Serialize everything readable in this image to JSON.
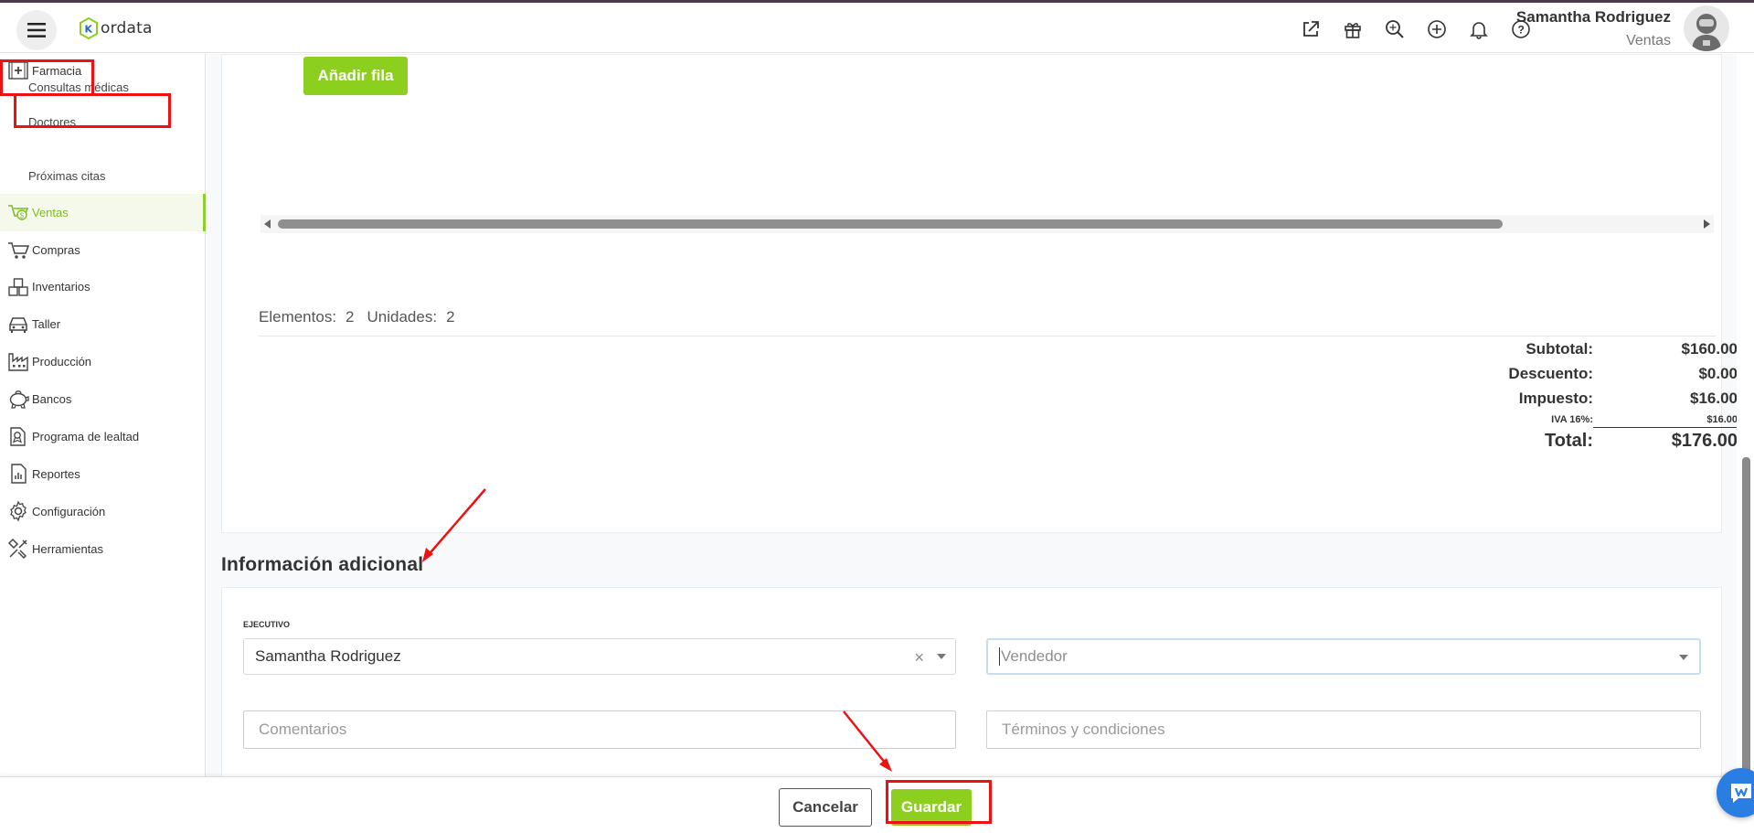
{
  "app": {
    "logo_text": "ordata",
    "logo_letter": "K"
  },
  "header": {
    "user_name": "Samantha Rodriguez",
    "user_role": "Ventas",
    "icons": [
      "external-link-icon",
      "gift-icon",
      "search-icon",
      "plus-circle-icon",
      "bell-icon",
      "help-icon"
    ]
  },
  "sidebar": {
    "items": [
      {
        "label": "Farmacia",
        "icon": "pharmacy-icon"
      },
      {
        "label": "Consultas médicas"
      },
      {
        "label": "Doctores"
      },
      {
        "label": "Próximas citas"
      },
      {
        "label": "Ventas",
        "icon": "sales-icon",
        "active": true
      },
      {
        "label": "Compras",
        "icon": "cart-icon"
      },
      {
        "label": "Inventarios",
        "icon": "boxes-icon"
      },
      {
        "label": "Taller",
        "icon": "car-icon"
      },
      {
        "label": "Producción",
        "icon": "factory-icon"
      },
      {
        "label": "Bancos",
        "icon": "piggy-bank-icon"
      },
      {
        "label": "Programa de lealtad",
        "icon": "loyalty-icon"
      },
      {
        "label": "Reportes",
        "icon": "report-icon"
      },
      {
        "label": "Configuración",
        "icon": "gear-icon"
      },
      {
        "label": "Herramientas",
        "icon": "tools-icon"
      }
    ]
  },
  "main": {
    "add_row_label": "Añadir fila",
    "counts": {
      "elements_label": "Elementos:",
      "elements_value": "2",
      "units_label": "Unidades:",
      "units_value": "2"
    },
    "totals": {
      "subtotal_label": "Subtotal:",
      "subtotal_value": "$160.00",
      "discount_label": "Descuento:",
      "discount_value": "$0.00",
      "tax_label": "Impuesto:",
      "tax_value": "$16.00",
      "iva_label": "IVA 16%:",
      "iva_value": "$16.00",
      "total_label": "Total:",
      "total_value": "$176.00"
    },
    "additional": {
      "title": "Información adicional",
      "executive_label": "EJECUTIVO",
      "executive_value": "Samantha Rodriguez",
      "seller_placeholder": "Vendedor",
      "comments_placeholder": "Comentarios",
      "terms_placeholder": "Términos y condiciones"
    }
  },
  "footer": {
    "cancel_label": "Cancelar",
    "save_label": "Guardar"
  },
  "colors": {
    "accent": "#8ccf1f",
    "annotation": "#ee1111",
    "chat": "#2a7de1"
  }
}
